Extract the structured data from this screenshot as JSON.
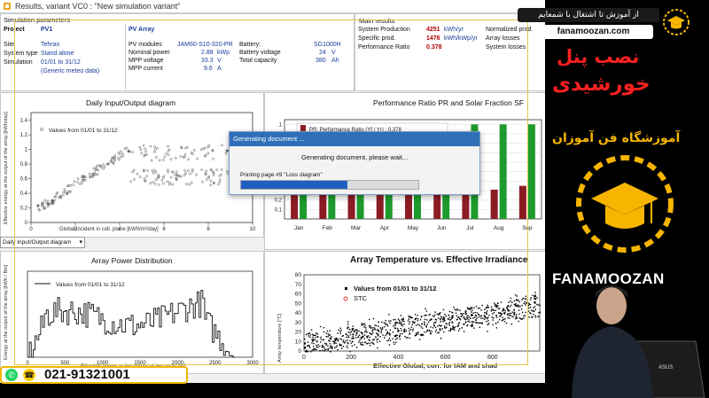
{
  "window": {
    "title": "Results, variant VC0 : \"New simulation variant\""
  },
  "params": {
    "header": "Simulation parameters",
    "project_label": "Project",
    "project_value": "PV1",
    "pv_array_label": "PV Array",
    "site_label": "Site",
    "site_value": "Tehran",
    "system_type_label": "System type",
    "system_type_value": "Stand alone",
    "simulation_label": "Simulation",
    "simulation_value": "01/01 to 31/12",
    "meteo_value": "(Generic meteo data)",
    "pv_modules_label": "PV modules",
    "pv_modules_value": "JAM60-S10-320-PR",
    "nominal_power_label": "Nominal power",
    "nominal_power_value": "2.88",
    "nominal_power_unit": "kWp",
    "mpp_voltage_label": "MPP voltage",
    "mpp_voltage_value": "33.3",
    "mpp_voltage_unit": "V",
    "mpp_current_label": "MPP current",
    "mpp_current_value": "9.6",
    "mpp_current_unit": "A",
    "battery_label": "Battery:",
    "battery_value": "SG1000H",
    "battery_voltage_label": "Battery voltage",
    "battery_voltage_value": "24",
    "battery_voltage_unit": "V",
    "total_capacity_label": "Total capacity",
    "total_capacity_value": "380",
    "total_capacity_unit": "Ah"
  },
  "results": {
    "header": "Main results",
    "system_production_label": "System Production",
    "system_production_value": "4251",
    "system_production_unit": "kWh/yr",
    "specific_prod_label": "Specific prod.",
    "specific_prod_value": "1476",
    "specific_prod_unit": "kWh/kWp/yr",
    "performance_ratio_label": "Performance Ratio",
    "performance_ratio_value": "0.378",
    "normalized_prod_label": "Normalized prod.",
    "array_losses_label": "Array losses",
    "system_losses_label": "System losses"
  },
  "io_diagram": {
    "title": "Daily Input/Output diagram",
    "legend": "Values from 01/01 to 31/12",
    "xlabel": "Global incident in coll. plane [kWh/m²/day]",
    "ylabel": "Effective energy at the output of the array [kWh/day]",
    "xticks": [
      "0",
      "2",
      "4",
      "6",
      "8",
      "10"
    ],
    "yticks": [
      "0",
      "0.2",
      "0.4",
      "0.6",
      "0.8",
      "1",
      "1.2",
      "1.4"
    ]
  },
  "dropdown": {
    "value": "Daily Input/Output diagram"
  },
  "pr_chart": {
    "title": "Performance Ratio PR  and Solar Fraction SF",
    "legend_pr": "PR: Performance Ratio (Yf / Yr) :   0.378",
    "months": [
      "Jan",
      "Feb",
      "Mar",
      "Apr",
      "May",
      "Jun",
      "Jul",
      "Aug",
      "Sep"
    ],
    "yticks": [
      "0.1",
      "0.2",
      "0.3",
      "0.4",
      "0.5",
      "0.6",
      "0.7",
      "0.8",
      "0.9",
      "1"
    ],
    "pr_color": "#8b1c24",
    "sf_color": "#1f9a2e"
  },
  "chart_data": [
    {
      "type": "bar",
      "title": "Performance Ratio PR  and Solar Fraction SF",
      "categories": [
        "Jan",
        "Feb",
        "Mar",
        "Apr",
        "May",
        "Jun",
        "Jul",
        "Aug",
        "Sep"
      ],
      "series": [
        {
          "name": "PR: Performance Ratio (Yf / Yr) :   0.378",
          "values": [
            0.55,
            0.46,
            0.55,
            0.44,
            0.46,
            0.41,
            0.38,
            0.31,
            0.35
          ]
        },
        {
          "name": "SF",
          "values": [
            0.84,
            0.78,
            0.92,
            0.8,
            0.98,
            0.85,
            1.0,
            1.0,
            1.0
          ]
        }
      ],
      "ylim": [
        0,
        1.05
      ]
    },
    {
      "type": "line",
      "title": "Array Power Distribution",
      "xlabel": "Effective power at the output of the array [W]",
      "ylabel": "Energy at the output of the array [kWh / Bin]",
      "series": [
        {
          "name": "Values from 01/01 to 31/12"
        }
      ],
      "xlim": [
        0,
        3000
      ]
    },
    {
      "type": "scatter",
      "title": "Array Temperature vs. Effective Irradiance",
      "xlabel": "Effective Global, corr. for IAM and shad",
      "ylabel": "Array temperature [°C]",
      "series": [
        {
          "name": "Values from 01/01 to 31/12"
        },
        {
          "name": "STC"
        }
      ],
      "xlim": [
        0,
        1000
      ]
    }
  ],
  "dist_chart": {
    "title": "Array Power Distribution",
    "legend": "Values from 01/01 to 31/12",
    "xlabel": "Effective power at the output of the array [W]",
    "ylabel": "Energy at the output of the array [kWh / Bin]",
    "xticks": [
      "0",
      "500",
      "1000",
      "1500",
      "2000",
      "2500",
      "3000"
    ]
  },
  "temp_chart": {
    "title": "Array Temperature vs. Effective Irradiance",
    "legend": "Values from 01/01 to 31/12",
    "legend_stc": "STC",
    "xlabel": "Effective Global, corr. for IAM and shad",
    "ylabel": "Array temperature [°C]",
    "xticks": [
      "0",
      "200",
      "400",
      "600",
      "800"
    ],
    "yticks": [
      "0",
      "10",
      "20",
      "30",
      "40",
      "50",
      "60",
      "70",
      "80"
    ]
  },
  "dialog": {
    "title": "Generating document ...",
    "message": "Generating document, please wait...",
    "printing": "Printing page #9 \"Loss diagram\"",
    "progress": 0.6
  },
  "promo": {
    "top_text": "از آموزش تا اشتغال با شمعایم",
    "site": "fanamoozan.com",
    "title1": "نصب پنل",
    "title2": "خورشیدی",
    "subtitle": "آموزشگاه فن آموزان",
    "brand": "FANAMOOZAN",
    "phone": "021-91321001"
  },
  "laptop_brand": "ASUS"
}
